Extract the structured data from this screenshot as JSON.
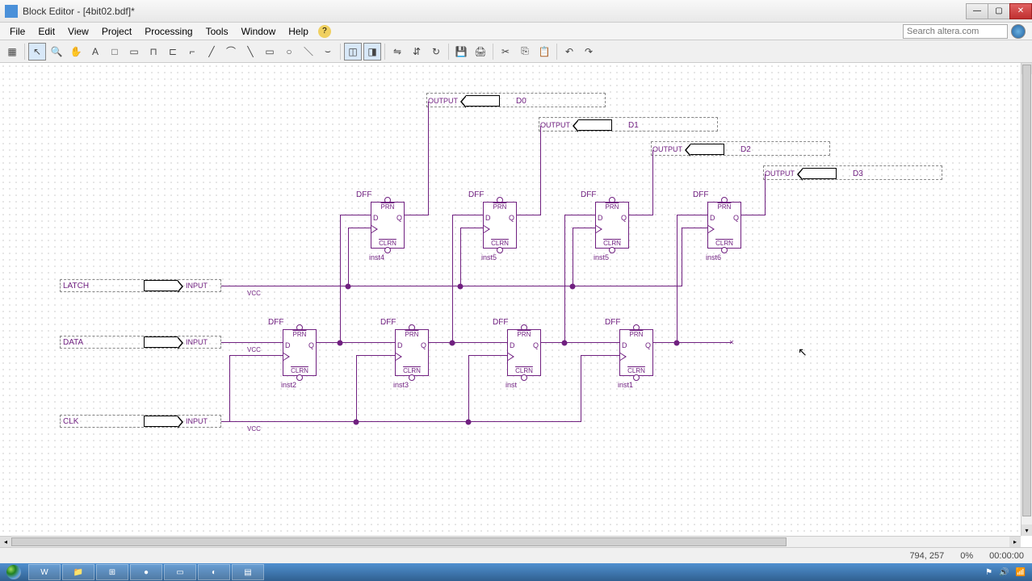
{
  "window": {
    "title": "Block Editor - [4bit02.bdf]*"
  },
  "menu": {
    "file": "File",
    "edit": "Edit",
    "view": "View",
    "project": "Project",
    "processing": "Processing",
    "tools": "Tools",
    "window": "Window",
    "help": "Help"
  },
  "search": {
    "placeholder": "Search altera.com"
  },
  "circuit": {
    "inputs": {
      "latch": {
        "name": "LATCH",
        "type": "INPUT",
        "sub": "VCC"
      },
      "data": {
        "name": "DATA",
        "type": "INPUT",
        "sub": "VCC"
      },
      "clk": {
        "name": "CLK",
        "type": "INPUT",
        "sub": "VCC"
      }
    },
    "outputs": {
      "d0": {
        "type": "OUTPUT",
        "name": "D0"
      },
      "d1": {
        "type": "OUTPUT",
        "name": "D1"
      },
      "d2": {
        "type": "OUTPUT",
        "name": "D2"
      },
      "d3": {
        "type": "OUTPUT",
        "name": "D3"
      }
    },
    "dff": {
      "type": "DFF",
      "prn": "PRN",
      "d": "D",
      "q": "Q",
      "clrn": "CLRN",
      "top": [
        "inst4",
        "inst5",
        "inst5",
        "inst6"
      ],
      "bot": [
        "inst2",
        "inst3",
        "inst",
        "inst1"
      ]
    }
  },
  "status": {
    "coords": "794, 257",
    "percent": "0%",
    "time": "00:00:00"
  }
}
